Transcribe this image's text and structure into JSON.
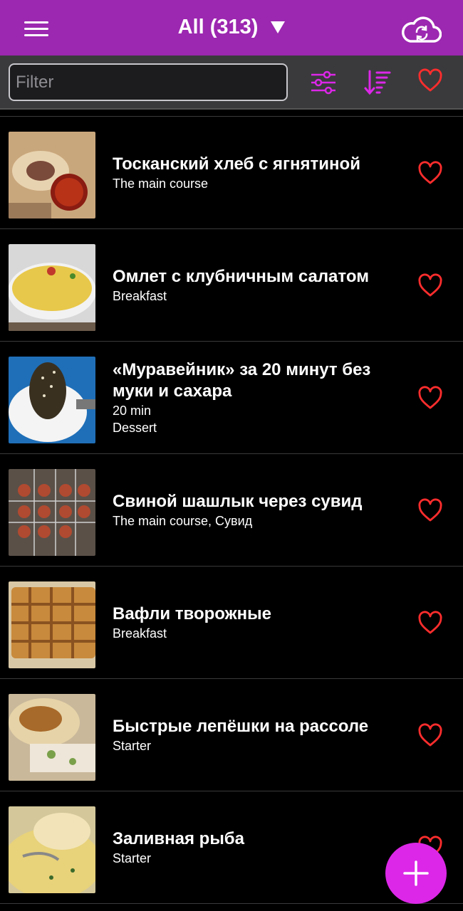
{
  "header": {
    "title": "All (313)",
    "menu_icon": "hamburger-icon",
    "dropdown_icon": "caret-down-icon",
    "sync_icon": "cloud-sync-icon"
  },
  "toolbar": {
    "filter_placeholder": "Filter",
    "filter_value": "",
    "settings_icon": "sliders-icon",
    "sort_icon": "sort-descending-icon",
    "favorites_icon": "heart-outline-icon"
  },
  "colors": {
    "header": "#9c27b0",
    "accent": "#dc27e8",
    "heart": "#ff2d2d",
    "toolbar": "#3a3a3c"
  },
  "recipes": [
    {
      "title": "Тосканский хлеб с ягнятиной",
      "lines": [
        "The main course"
      ]
    },
    {
      "title": "Омлет с клубничным салатом",
      "lines": [
        "Breakfast"
      ]
    },
    {
      "title": "«Муравейник» за 20 минут без муки и сахара",
      "lines": [
        "20 min",
        "Dessert"
      ]
    },
    {
      "title": "Свиной шашлык через сувид",
      "lines": [
        "The main course, Сувид"
      ]
    },
    {
      "title": "Вафли творожные",
      "lines": [
        "Breakfast"
      ]
    },
    {
      "title": "Быстрые лепёшки на рассоле",
      "lines": [
        "Starter"
      ]
    },
    {
      "title": "Заливная рыба",
      "lines": [
        "Starter"
      ]
    }
  ],
  "fab": {
    "icon": "plus-icon"
  }
}
